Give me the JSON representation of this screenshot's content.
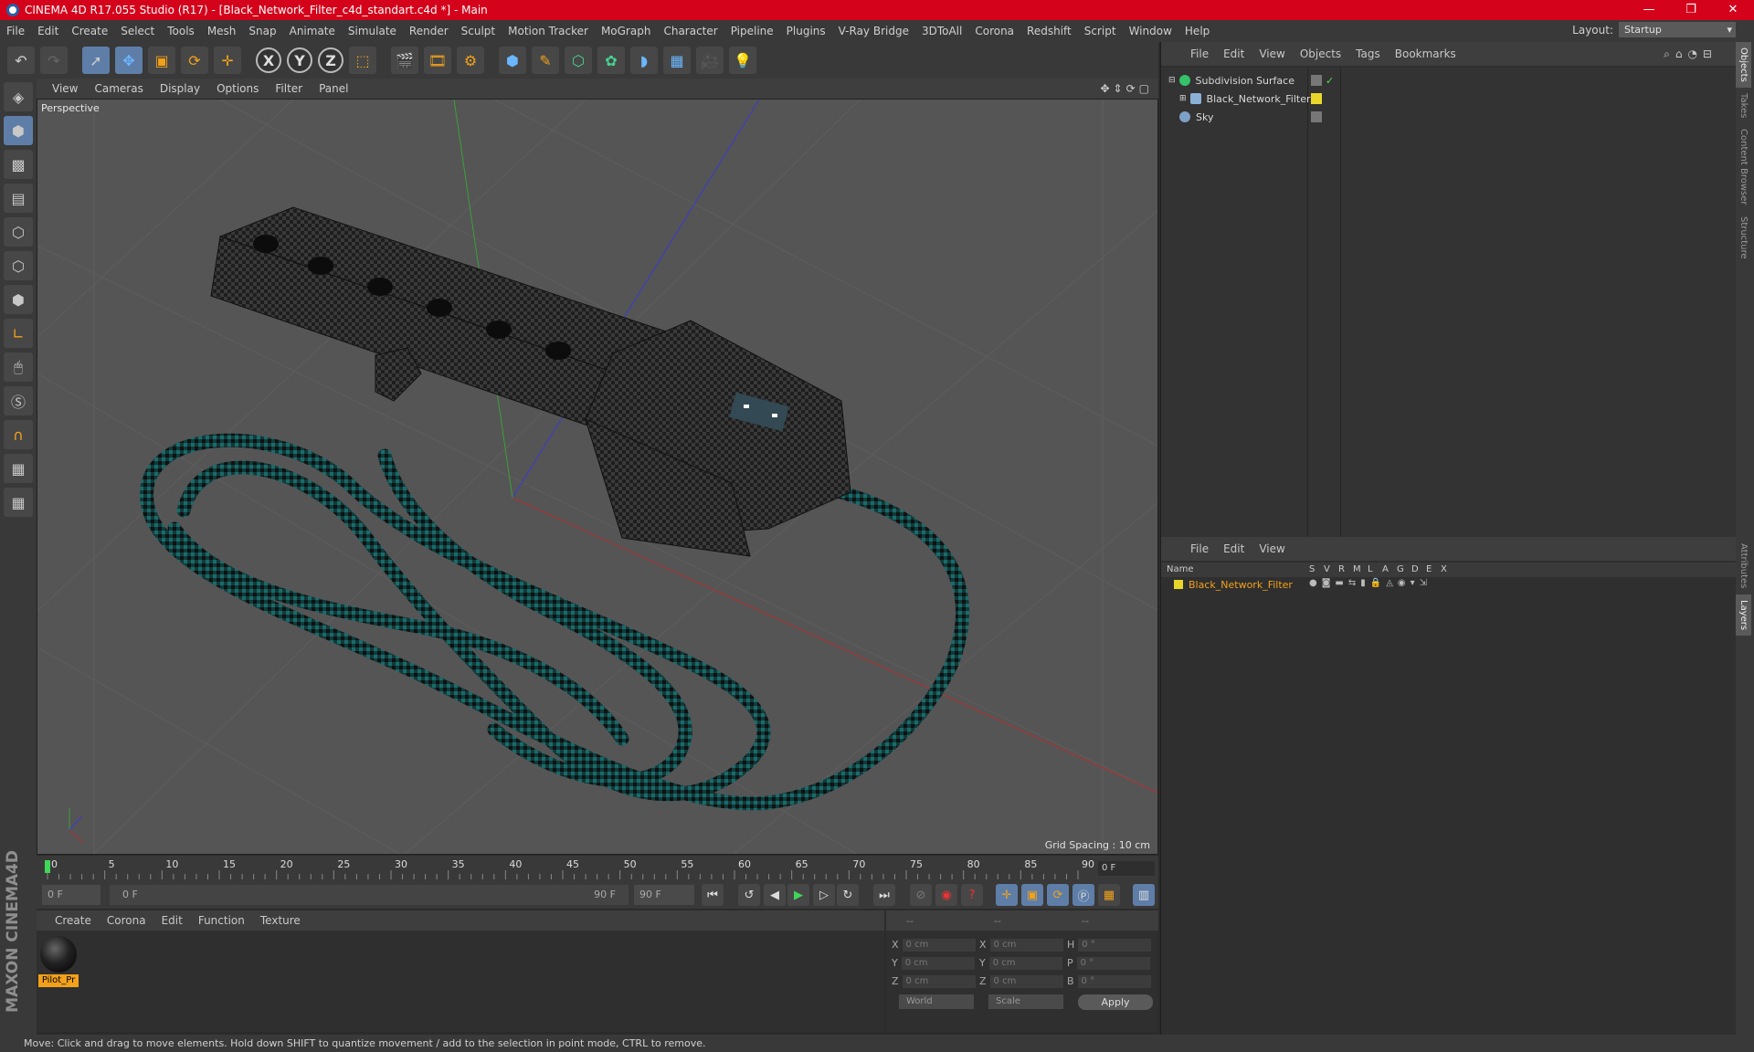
{
  "window": {
    "title": "CINEMA 4D R17.055 Studio (R17) - [Black_Network_Filter_c4d_standart.c4d *] - Main",
    "controls": [
      "—",
      "❐",
      "✕"
    ]
  },
  "menubar": {
    "items": [
      "File",
      "Edit",
      "Create",
      "Select",
      "Tools",
      "Mesh",
      "Snap",
      "Animate",
      "Simulate",
      "Render",
      "Sculpt",
      "Motion Tracker",
      "MoGraph",
      "Character",
      "Pipeline",
      "Plugins",
      "V-Ray Bridge",
      "3DToAll",
      "Corona",
      "Redshift",
      "Script",
      "Window",
      "Help"
    ],
    "layout_label": "Layout:",
    "layout_value": "Startup"
  },
  "viewport": {
    "menu": [
      "View",
      "Cameras",
      "Display",
      "Options",
      "Filter",
      "Panel"
    ],
    "label": "Perspective",
    "grid_spacing": "Grid Spacing : 10 cm"
  },
  "timeline": {
    "ticks": [
      "0",
      "5",
      "10",
      "15",
      "20",
      "25",
      "30",
      "35",
      "40",
      "45",
      "50",
      "55",
      "60",
      "65",
      "70",
      "75",
      "80",
      "85",
      "90"
    ],
    "current_frame": "0 F",
    "start_field": "0 F",
    "range_start": "0 F",
    "range_end": "90 F",
    "end_field": "90 F"
  },
  "material_panel": {
    "menu": [
      "Create",
      "Corona",
      "Edit",
      "Function",
      "Texture"
    ],
    "materials": [
      {
        "name": "Pilot_Pr"
      }
    ]
  },
  "coords": {
    "headers": [
      "--",
      "--",
      "--"
    ],
    "rows": [
      {
        "a": "X",
        "v1": "0 cm",
        "b": "X",
        "v2": "0 cm",
        "c": "H",
        "v3": "0 °"
      },
      {
        "a": "Y",
        "v1": "0 cm",
        "b": "Y",
        "v2": "0 cm",
        "c": "P",
        "v3": "0 °"
      },
      {
        "a": "Z",
        "v1": "0 cm",
        "b": "Z",
        "v2": "0 cm",
        "c": "B",
        "v3": "0 °"
      }
    ],
    "mode1": "World",
    "mode2": "Scale",
    "apply": "Apply"
  },
  "objects_panel": {
    "menu": [
      "File",
      "Edit",
      "View",
      "Objects",
      "Tags",
      "Bookmarks"
    ],
    "objects": [
      {
        "name": "Subdivision Surface",
        "color": "#34c16a"
      },
      {
        "name": "Black_Network_Filter",
        "color": "#8ab0d8"
      },
      {
        "name": "Sky",
        "color": "#7da0c6"
      }
    ]
  },
  "layers_panel": {
    "menu": [
      "File",
      "Edit",
      "View"
    ],
    "columns": [
      "Name",
      "S",
      "V",
      "R",
      "M",
      "L",
      "A",
      "G",
      "D",
      "E",
      "X"
    ],
    "layers": [
      {
        "name": "Black_Network_Filter"
      }
    ]
  },
  "side_tabs": [
    "Objects",
    "Takes",
    "Content Browser",
    "Structure",
    "Attributes",
    "Layers"
  ],
  "statusbar": {
    "text": "Move: Click and drag to move elements. Hold down SHIFT to quantize movement / add to the selection in point mode, CTRL to remove."
  },
  "colors": {
    "accent": "#f2a11a",
    "title_red": "#d4031b",
    "selected_blue": "#5e7ea8"
  }
}
